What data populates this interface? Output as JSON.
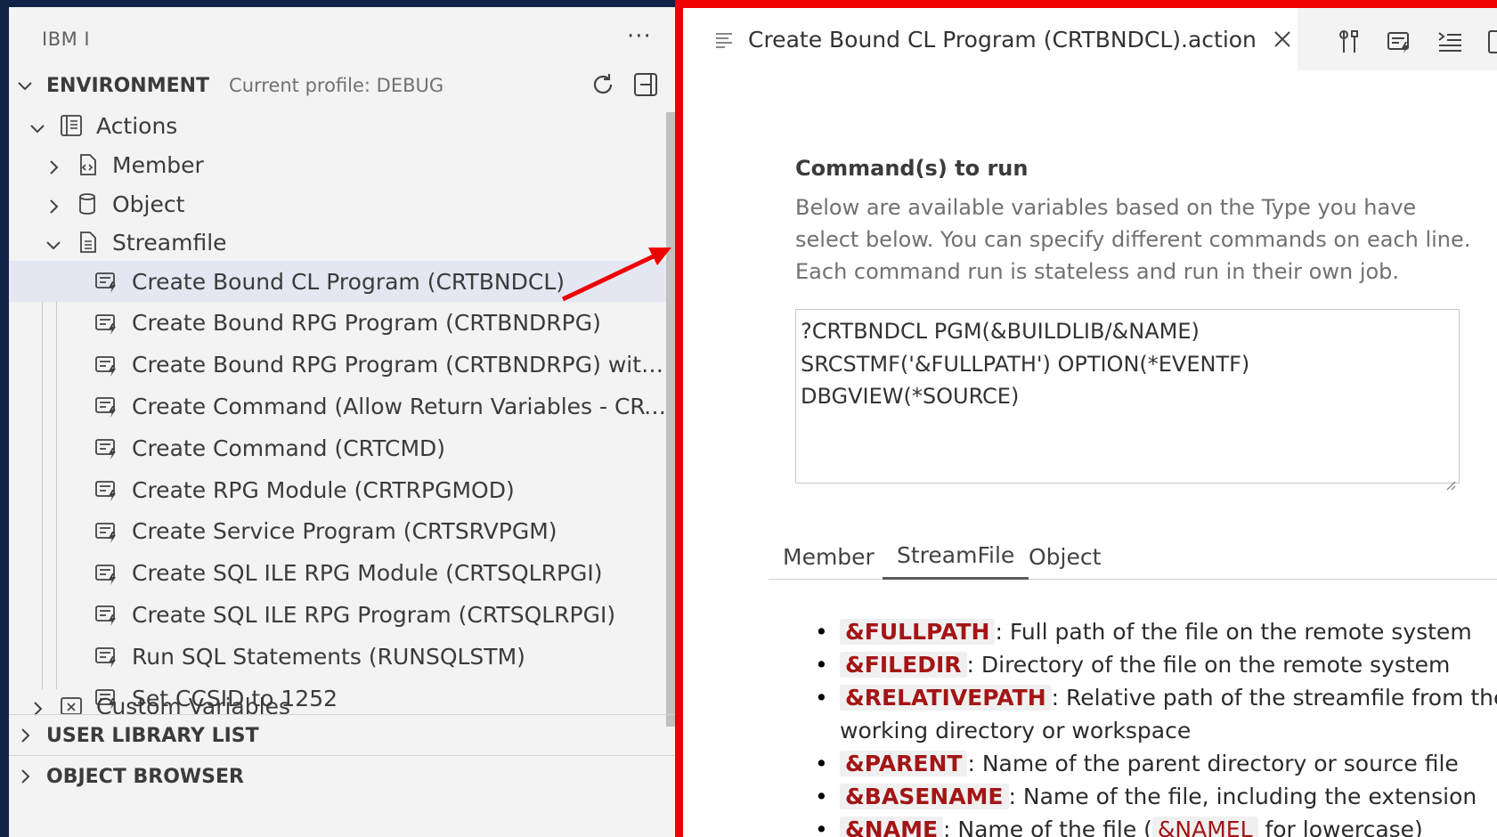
{
  "sidebar": {
    "title": "IBM I",
    "more_label": "···",
    "environment": {
      "name": "ENVIRONMENT",
      "profile": "Current profile: DEBUG"
    },
    "tree": {
      "actions": "Actions",
      "member": "Member",
      "object": "Object",
      "streamfile": "Streamfile",
      "items": [
        "Create Bound CL Program (CRTBNDCL)",
        "Create Bound RPG Program (CRTBNDRPG)",
        "Create Bound RPG Program (CRTBNDRPG) with...",
        "Create Command (Allow Return Variables - CRT...",
        "Create Command (CRTCMD)",
        "Create RPG Module (CRTRPGMOD)",
        "Create Service Program (CRTSRVPGM)",
        "Create SQL ILE RPG Module (CRTSQLRPGI)",
        "Create SQL ILE RPG Program (CRTSQLRPGI)",
        "Run SQL Statements (RUNSQLSTM)",
        "Set CCSID to 1252"
      ],
      "custom_variables": "Custom Variables"
    },
    "user_library_list": "USER LIBRARY LIST",
    "object_browser": "OBJECT BROWSER"
  },
  "editor": {
    "tab_label": "Create Bound CL Program (CRTBNDCL).action",
    "field_title": "Command(s) to run",
    "field_desc": "Below are available variables based on the Type you have select below. You can specify different commands on each line. Each command run is stateless and run in their own job.",
    "command_lines": [
      "?CRTBNDCL PGM(&BUILDLIB/&NAME)",
      "SRCSTMF('&FULLPATH') OPTION(*EVENTF)",
      "DBGVIEW(*SOURCE)"
    ],
    "subtabs": [
      "Member",
      "StreamFile",
      "Object"
    ],
    "variables": [
      {
        "code": "&FULLPATH",
        "text": ": Full path of the file on the remote system"
      },
      {
        "code": "&FILEDIR",
        "text": ": Directory of the file on the remote system"
      },
      {
        "code": "&RELATIVEPATH",
        "text": ": Relative path of the streamfile from the working directory or workspace"
      },
      {
        "code": "&PARENT",
        "text": ": Name of the parent directory or source file"
      },
      {
        "code": "&BASENAME",
        "text": ": Name of the file, including the extension"
      },
      {
        "code": "&NAME",
        "text": ": Name of the file (",
        "code2": "&NAMEL",
        "text2": "for lowercase)"
      }
    ]
  },
  "colors": {
    "highlight_border": "#ee0000",
    "variable_code": "#a31515",
    "selected_row": "#e4e6f1"
  }
}
